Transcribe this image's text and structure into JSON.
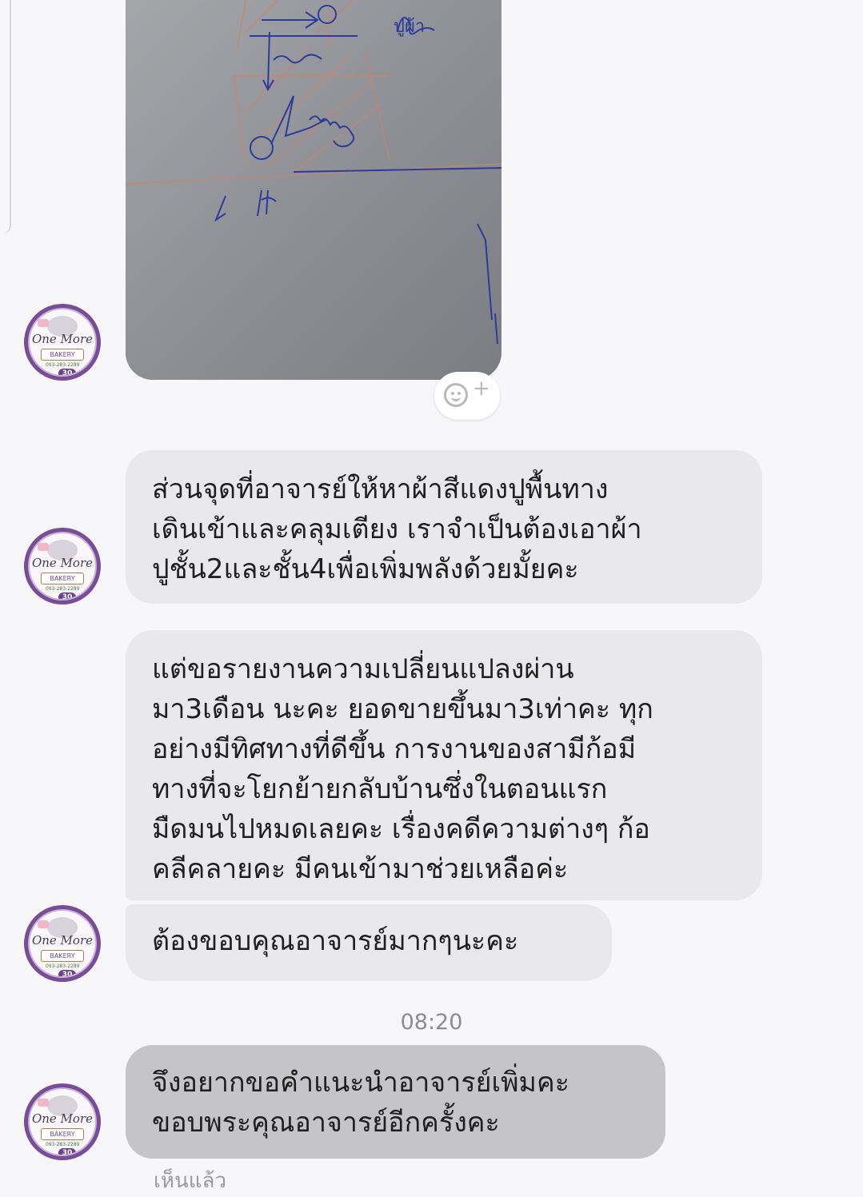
{
  "avatar": {
    "brand_title": "One More",
    "brand_sub": "BAKERY",
    "phone": "093-283-2289",
    "badge": "30",
    "color": "#7a4c98"
  },
  "photo_message": {
    "description_icon": "whiteboard-photo",
    "sketch_color": "#2a3c9c",
    "handwriting": "ปูผ้า"
  },
  "reaction": {
    "icon": "smiley-add-icon",
    "plus": "+"
  },
  "messages": [
    {
      "lines": [
        "ส่วนจุดที่อาจารย์ให้หาผ้าสีแดงปูพื้นทาง",
        "เดินเข้าและคลุมเตียง เราจำเป็นต้องเอาผ้า",
        "ปูชั้น2และชั้น4เพื่อเพิ่มพลังด้วยมั้ยคะ"
      ]
    },
    {
      "lines": [
        "แต่ขอรายงานความเปลี่ยนแปลงผ่าน",
        "มา3เดือน นะคะ ยอดขายขึ้นมา3เท่าคะ ทุก",
        "อย่างมีทิศทางที่ดีขึ้น การงานของสามีก้อมี",
        "ทางที่จะโยกย้ายกลับบ้านซึ่งในตอนแรก",
        "มืดมนไปหมดเลยคะ เรื่องคดีความต่างๆ ก้อ",
        "คลีคลายคะ มีคนเข้ามาช่วยเหลือค่ะ"
      ]
    },
    {
      "lines": [
        "ต้องขอบคุณอาจารย์มากๆนะคะ"
      ]
    },
    {
      "lines": [
        "จึงอยากขอคำแนะนำอาจารย์เพิ่มคะ",
        "ขอบพระคุณอาจารย์อีกครั้งคะ"
      ]
    }
  ],
  "timestamp": "08:20",
  "seen_label": "เห็นแล้ว",
  "colors": {
    "background": "#f7f7f9",
    "bubble": "#e9e9ec",
    "bubble_selected": "#c5c5c8",
    "meta_text": "#8c8c90"
  }
}
